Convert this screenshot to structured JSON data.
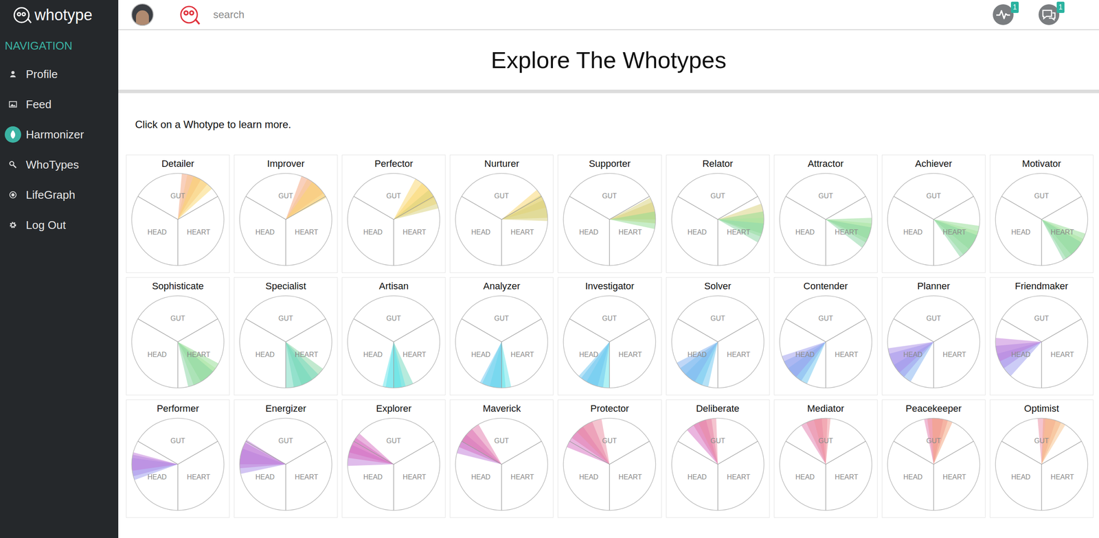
{
  "logo": {
    "text": "whotype"
  },
  "topbar": {
    "search": {
      "placeholder": "search"
    },
    "notifications": [
      {
        "badge": "1"
      },
      {
        "badge": "1"
      }
    ]
  },
  "sidebar": {
    "heading": "NAVIGATION",
    "items": [
      {
        "label": "Profile"
      },
      {
        "label": "Feed"
      },
      {
        "label": "Harmonizer"
      },
      {
        "label": "WhoTypes"
      },
      {
        "label": "LifeGraph"
      },
      {
        "label": "Log Out"
      }
    ]
  },
  "page": {
    "title": "Explore The Whotypes",
    "intro": "Click on a Whotype to learn more."
  },
  "sector_labels": {
    "gut": "GUT",
    "head": "HEAD",
    "heart": "HEART"
  },
  "whotypes": [
    {
      "name": "Detailer",
      "wedges": [
        {
          "from": 5,
          "to": 30,
          "color": "#f4a27a"
        },
        {
          "from": 12,
          "to": 40,
          "color": "#f8c28a"
        },
        {
          "from": 20,
          "to": 48,
          "color": "#f9d66a"
        }
      ]
    },
    {
      "name": "Improver",
      "wedges": [
        {
          "from": 20,
          "to": 55,
          "color": "#f4a27a"
        },
        {
          "from": 28,
          "to": 60,
          "color": "#f8c28a"
        },
        {
          "from": 35,
          "to": 62,
          "color": "#f9d66a"
        }
      ]
    },
    {
      "name": "Perfector",
      "wedges": [
        {
          "from": 28,
          "to": 62,
          "color": "#f9d66a"
        },
        {
          "from": 38,
          "to": 70,
          "color": "#f9d66a"
        },
        {
          "from": 50,
          "to": 76,
          "color": "#d8cf78"
        }
      ]
    },
    {
      "name": "Nurturer",
      "wedges": [
        {
          "from": 50,
          "to": 75,
          "color": "#f9d66a"
        },
        {
          "from": 58,
          "to": 88,
          "color": "#d8cf78"
        },
        {
          "from": 65,
          "to": 92,
          "color": "#d8cf78"
        }
      ]
    },
    {
      "name": "Supporter",
      "wedges": [
        {
          "from": 62,
          "to": 90,
          "color": "#d8cf78"
        },
        {
          "from": 68,
          "to": 95,
          "color": "#d8cf78"
        },
        {
          "from": 80,
          "to": 102,
          "color": "#8fdc90"
        }
      ]
    },
    {
      "name": "Relator",
      "wedges": [
        {
          "from": 70,
          "to": 95,
          "color": "#d8cf78"
        },
        {
          "from": 80,
          "to": 108,
          "color": "#8fdc90"
        },
        {
          "from": 88,
          "to": 112,
          "color": "#a8e6a0"
        },
        {
          "from": 95,
          "to": 120,
          "color": "#86d4a0"
        }
      ]
    },
    {
      "name": "Attractor",
      "wedges": [
        {
          "from": 88,
          "to": 115,
          "color": "#8fdc90"
        },
        {
          "from": 95,
          "to": 120,
          "color": "#a8e6a0"
        },
        {
          "from": 100,
          "to": 128,
          "color": "#86d4a0"
        }
      ]
    },
    {
      "name": "Achiever",
      "wedges": [
        {
          "from": 98,
          "to": 130,
          "color": "#8fdc90"
        },
        {
          "from": 105,
          "to": 140,
          "color": "#a8e6a0"
        },
        {
          "from": 110,
          "to": 145,
          "color": "#86d4a0"
        }
      ]
    },
    {
      "name": "Motivator",
      "wedges": [
        {
          "from": 108,
          "to": 140,
          "color": "#8fdc90"
        },
        {
          "from": 115,
          "to": 148,
          "color": "#a8e6a0"
        },
        {
          "from": 120,
          "to": 152,
          "color": "#86d4a0"
        }
      ]
    },
    {
      "name": "Sophisticate",
      "wedges": [
        {
          "from": 118,
          "to": 150,
          "color": "#8fdc90"
        },
        {
          "from": 125,
          "to": 160,
          "color": "#a8e6a0"
        },
        {
          "from": 130,
          "to": 167,
          "color": "#86d4a0"
        }
      ]
    },
    {
      "name": "Specialist",
      "wedges": [
        {
          "from": 126,
          "to": 160,
          "color": "#86d4a0"
        },
        {
          "from": 135,
          "to": 170,
          "color": "#6fd8bc"
        },
        {
          "from": 145,
          "to": 180,
          "color": "#6fd8bc"
        }
      ]
    },
    {
      "name": "Artisan",
      "wedges": [
        {
          "from": 155,
          "to": 180,
          "color": "#6fd8bc"
        },
        {
          "from": 165,
          "to": 190,
          "color": "#5fe3ea"
        },
        {
          "from": 170,
          "to": 194,
          "color": "#5fe3ea"
        }
      ]
    },
    {
      "name": "Analyzer",
      "wedges": [
        {
          "from": 168,
          "to": 195,
          "color": "#5fe3ea"
        },
        {
          "from": 175,
          "to": 205,
          "color": "#5fe3ea"
        },
        {
          "from": 180,
          "to": 208,
          "color": "#6cc6f0"
        }
      ]
    },
    {
      "name": "Investigator",
      "wedges": [
        {
          "from": 180,
          "to": 210,
          "color": "#5fe3ea"
        },
        {
          "from": 188,
          "to": 218,
          "color": "#6cc6f0"
        },
        {
          "from": 195,
          "to": 222,
          "color": "#6cc6f0"
        }
      ]
    },
    {
      "name": "Solver",
      "wedges": [
        {
          "from": 192,
          "to": 225,
          "color": "#6cc6f0"
        },
        {
          "from": 200,
          "to": 235,
          "color": "#6cc6f0"
        },
        {
          "from": 210,
          "to": 243,
          "color": "#7fb0f0"
        }
      ]
    },
    {
      "name": "Contender",
      "wedges": [
        {
          "from": 204,
          "to": 235,
          "color": "#6cc6f0"
        },
        {
          "from": 212,
          "to": 245,
          "color": "#7fb0f0"
        },
        {
          "from": 220,
          "to": 252,
          "color": "#9a9aee"
        }
      ]
    },
    {
      "name": "Planner",
      "wedges": [
        {
          "from": 210,
          "to": 240,
          "color": "#7fb0f0"
        },
        {
          "from": 220,
          "to": 255,
          "color": "#9a9aee"
        },
        {
          "from": 228,
          "to": 262,
          "color": "#a88ce8"
        }
      ]
    },
    {
      "name": "Friendmaker",
      "wedges": [
        {
          "from": 222,
          "to": 255,
          "color": "#9a9aee"
        },
        {
          "from": 235,
          "to": 265,
          "color": "#a88ce8"
        },
        {
          "from": 245,
          "to": 275,
          "color": "#c07ad8"
        }
      ]
    },
    {
      "name": "Performer",
      "wedges": [
        {
          "from": 250,
          "to": 278,
          "color": "#9a9aee"
        },
        {
          "from": 255,
          "to": 282,
          "color": "#a88ce8"
        },
        {
          "from": 262,
          "to": 285,
          "color": "#c07ad8"
        }
      ]
    },
    {
      "name": "Energizer",
      "wedges": [
        {
          "from": 258,
          "to": 290,
          "color": "#a88ce8"
        },
        {
          "from": 265,
          "to": 298,
          "color": "#c07ad8"
        },
        {
          "from": 270,
          "to": 302,
          "color": "#c07ad8"
        }
      ]
    },
    {
      "name": "Explorer",
      "wedges": [
        {
          "from": 268,
          "to": 295,
          "color": "#c07ad8"
        },
        {
          "from": 278,
          "to": 305,
          "color": "#d66cc0"
        },
        {
          "from": 285,
          "to": 312,
          "color": "#d66cc0"
        }
      ]
    },
    {
      "name": "Maverick",
      "wedges": [
        {
          "from": 284,
          "to": 310,
          "color": "#c07ad8"
        },
        {
          "from": 292,
          "to": 320,
          "color": "#d66cc0"
        },
        {
          "from": 300,
          "to": 330,
          "color": "#e27aac"
        }
      ]
    },
    {
      "name": "Protector",
      "wedges": [
        {
          "from": 292,
          "to": 325,
          "color": "#d66cc0"
        },
        {
          "from": 305,
          "to": 338,
          "color": "#e27aac"
        },
        {
          "from": 315,
          "to": 350,
          "color": "#ea8aa0"
        }
      ]
    },
    {
      "name": "Deliberate",
      "wedges": [
        {
          "from": 318,
          "to": 345,
          "color": "#d66cc0"
        },
        {
          "from": 328,
          "to": 352,
          "color": "#e27aac"
        },
        {
          "from": 335,
          "to": 358,
          "color": "#ea8aa0"
        }
      ]
    },
    {
      "name": "Mediator",
      "wedges": [
        {
          "from": 328,
          "to": 355,
          "color": "#e27aac"
        },
        {
          "from": 335,
          "to": 362,
          "color": "#ea8aa0"
        },
        {
          "from": 345,
          "to": 366,
          "color": "#f0909a"
        }
      ]
    },
    {
      "name": "Peacekeeper",
      "wedges": [
        {
          "from": 348,
          "to": 372,
          "color": "#e27aac"
        },
        {
          "from": 352,
          "to": 378,
          "color": "#f0909a"
        },
        {
          "from": 358,
          "to": 384,
          "color": "#f4a27a"
        }
      ]
    },
    {
      "name": "Optimist",
      "wedges": [
        {
          "from": 355,
          "to": 378,
          "color": "#ea8aa0"
        },
        {
          "from": 362,
          "to": 385,
          "color": "#f4a27a"
        },
        {
          "from": 365,
          "to": 391,
          "color": "#f8c28a"
        }
      ]
    }
  ]
}
